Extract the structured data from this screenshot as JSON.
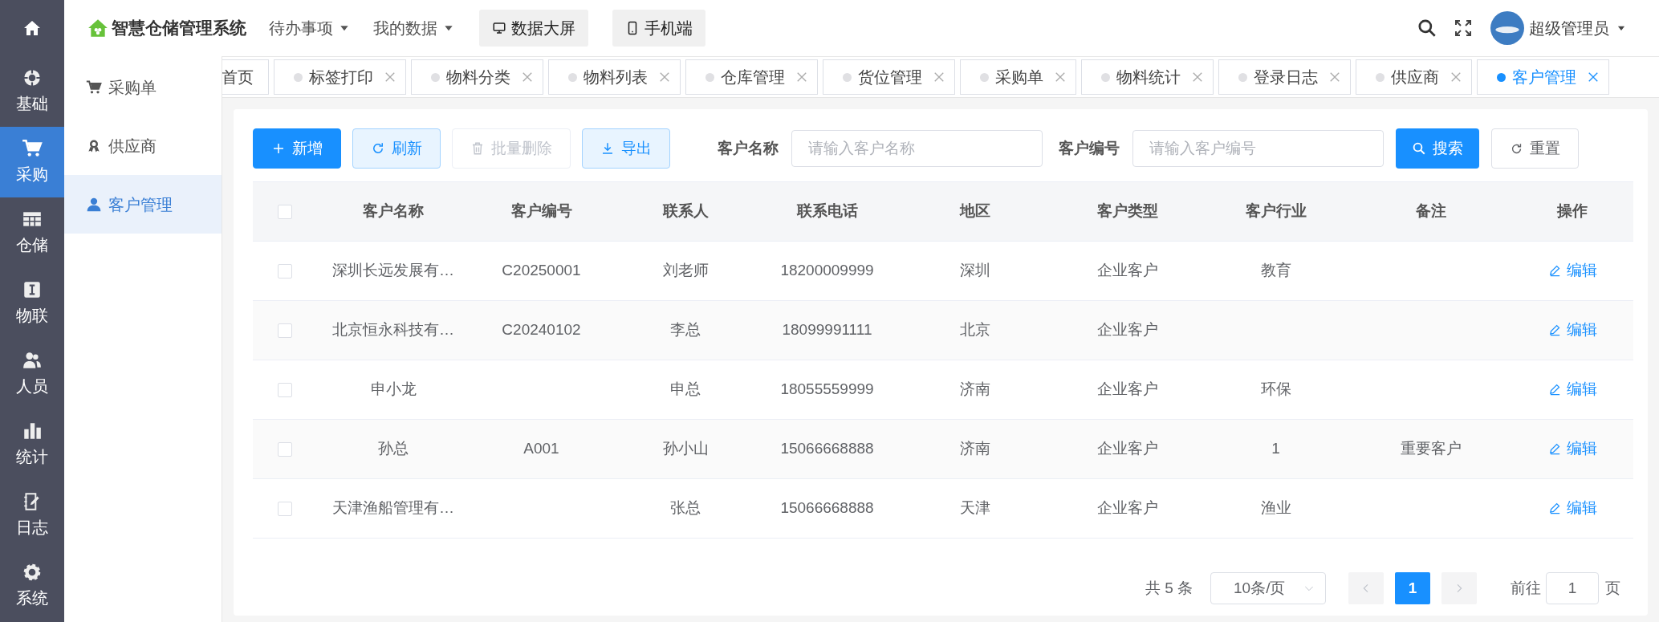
{
  "rail": {
    "items": [
      {
        "label": "基础",
        "selected": false
      },
      {
        "label": "采购",
        "selected": true
      },
      {
        "label": "仓储",
        "selected": false
      },
      {
        "label": "物联",
        "selected": false
      },
      {
        "label": "人员",
        "selected": false
      },
      {
        "label": "统计",
        "selected": false
      },
      {
        "label": "日志",
        "selected": false
      },
      {
        "label": "系统",
        "selected": false
      }
    ]
  },
  "header": {
    "title": "智慧仓储管理系统",
    "menus": [
      {
        "label": "待办事项",
        "kind": "dropdown"
      },
      {
        "label": "我的数据",
        "kind": "dropdown"
      },
      {
        "label": "数据大屏",
        "kind": "button"
      },
      {
        "label": "手机端",
        "kind": "button"
      }
    ],
    "user": "超级管理员"
  },
  "submenu": [
    {
      "label": "采购单",
      "selected": false
    },
    {
      "label": "供应商",
      "selected": false
    },
    {
      "label": "客户管理",
      "selected": true
    }
  ],
  "tabs": [
    {
      "label": "首页",
      "closable": false,
      "selected": false
    },
    {
      "label": "标签打印",
      "closable": true,
      "selected": false
    },
    {
      "label": "物料分类",
      "closable": true,
      "selected": false
    },
    {
      "label": "物料列表",
      "closable": true,
      "selected": false
    },
    {
      "label": "仓库管理",
      "closable": true,
      "selected": false
    },
    {
      "label": "货位管理",
      "closable": true,
      "selected": false
    },
    {
      "label": "采购单",
      "closable": true,
      "selected": false
    },
    {
      "label": "物料统计",
      "closable": true,
      "selected": false
    },
    {
      "label": "登录日志",
      "closable": true,
      "selected": false
    },
    {
      "label": "供应商",
      "closable": true,
      "selected": false
    },
    {
      "label": "客户管理",
      "closable": true,
      "selected": true
    }
  ],
  "toolbar": {
    "buttons": [
      {
        "label": "新增",
        "kind": "primary",
        "disabled": false
      },
      {
        "label": "刷新",
        "kind": "light",
        "disabled": false
      },
      {
        "label": "批量删除",
        "kind": "plain",
        "disabled": true
      },
      {
        "label": "导出",
        "kind": "light",
        "disabled": false
      }
    ],
    "filters": [
      {
        "label": "客户名称",
        "placeholder": "请输入客户名称"
      },
      {
        "label": "客户编号",
        "placeholder": "请输入客户编号"
      }
    ],
    "search": "搜索",
    "reset": "重置"
  },
  "table": {
    "select_all_checked": false,
    "columns": [
      "客户名称",
      "客户编号",
      "联系人",
      "联系电话",
      "地区",
      "客户类型",
      "客户行业",
      "备注",
      "操作"
    ],
    "rows": [
      {
        "checked": false,
        "cells": [
          "深圳长远发展有…",
          "C20250001",
          "刘老师",
          "18200009999",
          "深圳",
          "企业客户",
          "教育",
          ""
        ],
        "action": "编辑"
      },
      {
        "checked": false,
        "cells": [
          "北京恒永科技有…",
          "C20240102",
          "李总",
          "18099991111",
          "北京",
          "企业客户",
          "",
          ""
        ],
        "action": "编辑"
      },
      {
        "checked": false,
        "cells": [
          "申小龙",
          "",
          "申总",
          "18055559999",
          "济南",
          "企业客户",
          "环保",
          ""
        ],
        "action": "编辑"
      },
      {
        "checked": false,
        "cells": [
          "孙总",
          "A001",
          "孙小山",
          "15066668888",
          "济南",
          "企业客户",
          "1",
          "重要客户"
        ],
        "action": "编辑"
      },
      {
        "checked": false,
        "cells": [
          "天津渔船管理有…",
          "",
          "张总",
          "15066668888",
          "天津",
          "企业客户",
          "渔业",
          ""
        ],
        "action": "编辑"
      }
    ]
  },
  "pagination": {
    "total": "共 5 条",
    "page_size": "10条/页",
    "pages": [
      {
        "label": "1",
        "selected": true
      }
    ],
    "goto_label": "前往",
    "goto_value": "1",
    "goto_suffix": "页"
  }
}
